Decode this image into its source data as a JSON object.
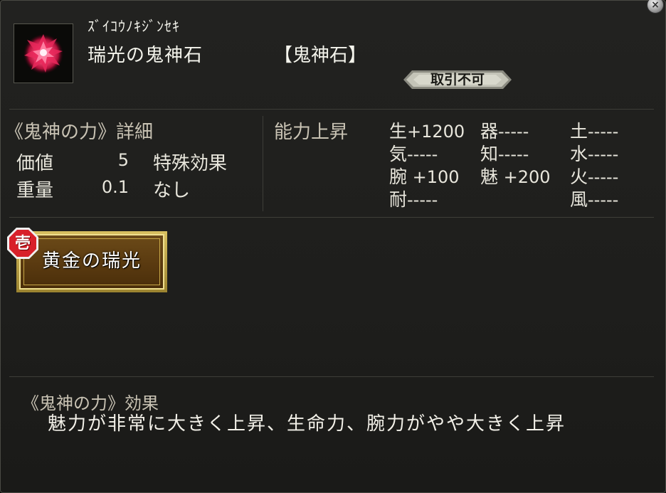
{
  "item": {
    "reading": "ｽﾞｲｺｳﾉｷｼﾞﾝｾｷ",
    "name": "瑞光の鬼神石",
    "category": "【鬼神石】",
    "trade_status": "取引不可",
    "icon": "red-crystal-gem-icon"
  },
  "details": {
    "title": "《鬼神の力》詳細",
    "value_label": "価値",
    "value": "5",
    "weight_label": "重量",
    "weight": "0.1",
    "special_label": "特殊効果",
    "special_value": "なし"
  },
  "abilities": {
    "title": "能力上昇",
    "stats": [
      {
        "key": "生",
        "value": "+1200"
      },
      {
        "key": "器",
        "value": "-----"
      },
      {
        "key": "土",
        "value": "-----"
      },
      {
        "key": "気",
        "value": "-----"
      },
      {
        "key": "知",
        "value": "-----"
      },
      {
        "key": "水",
        "value": "-----"
      },
      {
        "key": "腕",
        "value": " +100"
      },
      {
        "key": "魅",
        "value": " +200"
      },
      {
        "key": "火",
        "value": "-----"
      },
      {
        "key": "耐",
        "value": "-----"
      },
      {
        "key": "風",
        "value": "-----"
      }
    ]
  },
  "skill": {
    "rank": "壱",
    "name": "黄金の瑞光"
  },
  "effect": {
    "title": "《鬼神の力》効果",
    "text": "魅力が非常に大きく上昇、生命力、腕力がやや大きく上昇"
  },
  "colors": {
    "panel_bg": "#1e1e1c",
    "skill_gold": "#d8c060",
    "skill_brown": "#5a3a10",
    "rank_red": "#d8202a"
  }
}
